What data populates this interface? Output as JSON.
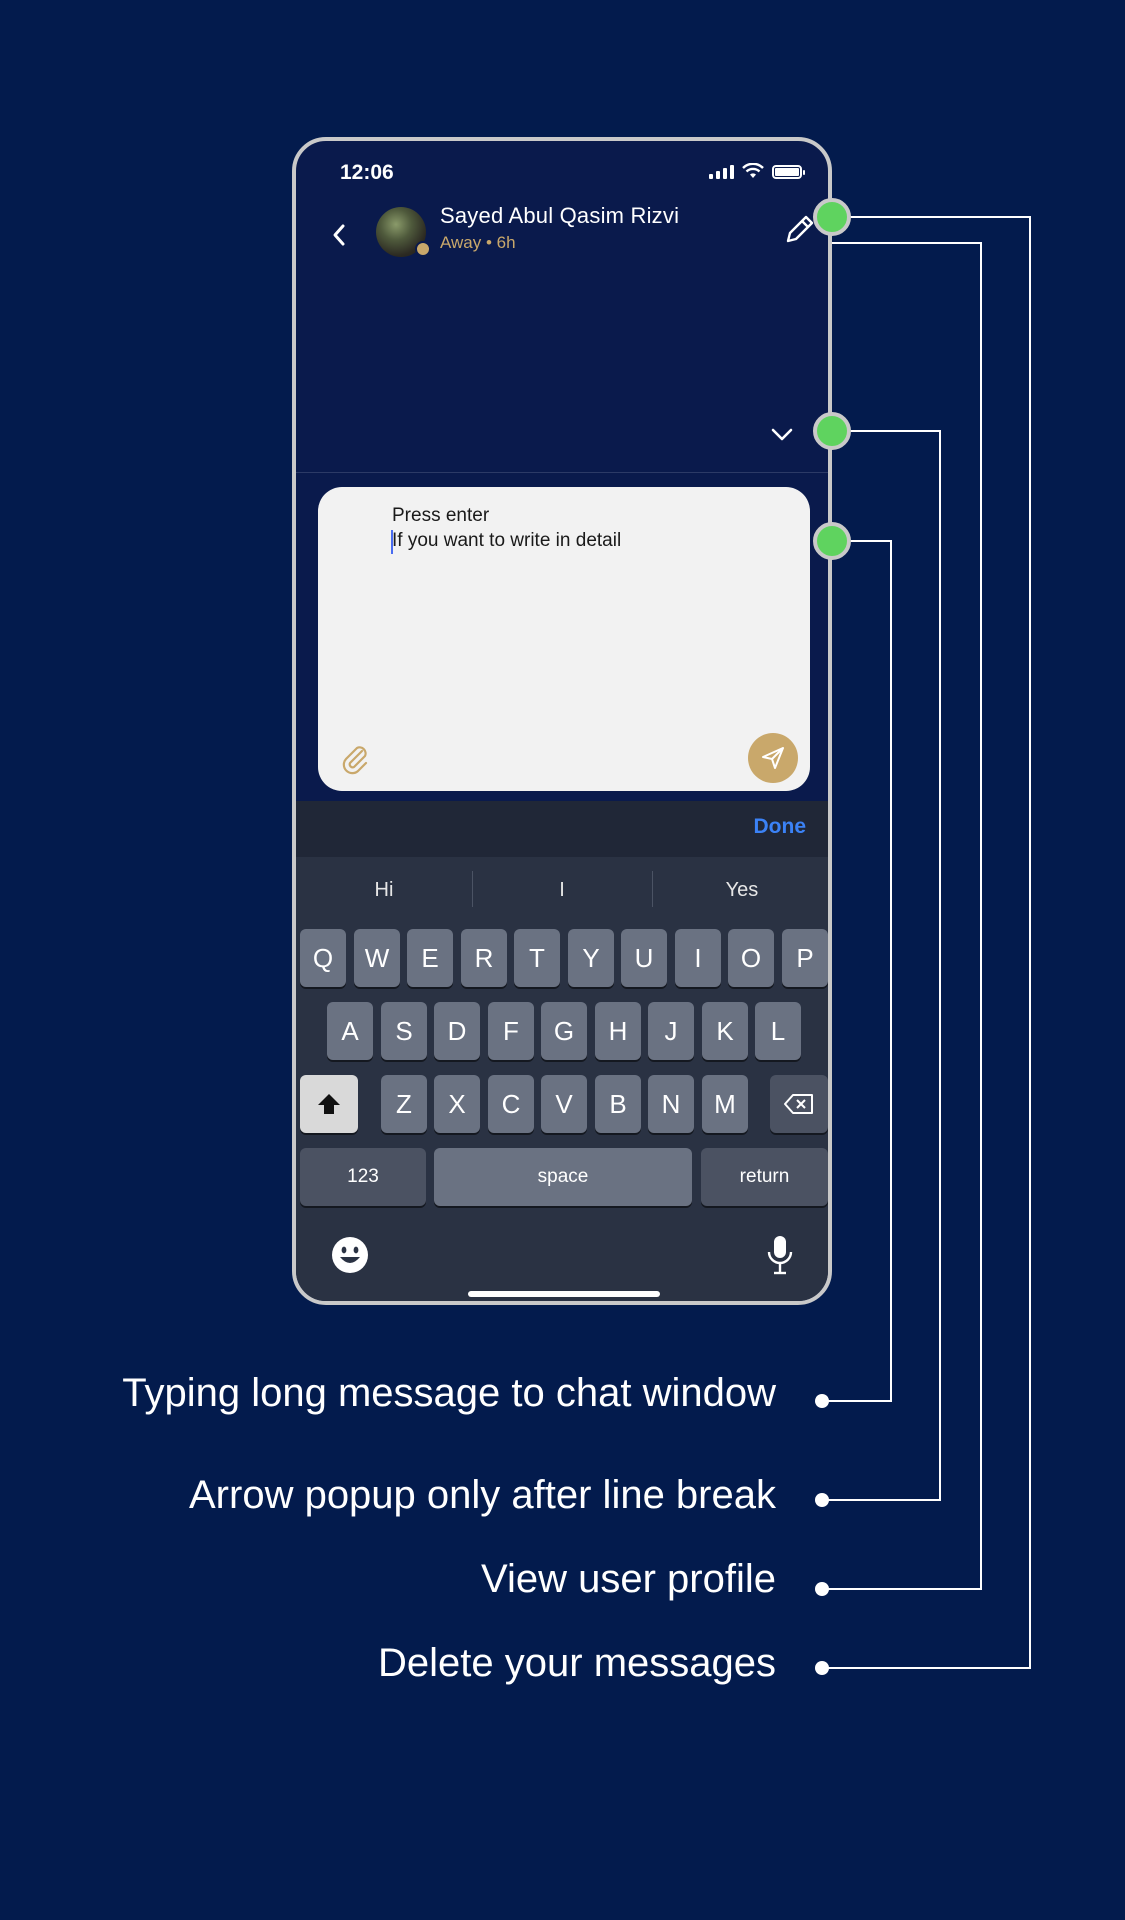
{
  "status_bar": {
    "time": "12:06"
  },
  "header": {
    "contact_name": "Sayed Abul Qasim Rizvi",
    "contact_status": "Away • 6h"
  },
  "composer": {
    "line1": "Press enter",
    "line2": "If you want to write in detail"
  },
  "keyboard": {
    "done_label": "Done",
    "suggestions": [
      "Hi",
      "I",
      "Yes"
    ],
    "row1": [
      "Q",
      "W",
      "E",
      "R",
      "T",
      "Y",
      "U",
      "I",
      "O",
      "P"
    ],
    "row2": [
      "A",
      "S",
      "D",
      "F",
      "G",
      "H",
      "J",
      "K",
      "L"
    ],
    "row3": [
      "Z",
      "X",
      "C",
      "V",
      "B",
      "N",
      "M"
    ],
    "numbers_label": "123",
    "space_label": "space",
    "return_label": "return"
  },
  "annotations": [
    "Typing long message to chat window",
    "Arrow popup only after line break",
    "View user profile",
    "Delete your messages"
  ],
  "colors": {
    "background": "#031b4d",
    "accent_gold": "#c9a86b",
    "marker_green": "#5fd35f",
    "done_blue": "#3b82f6"
  }
}
